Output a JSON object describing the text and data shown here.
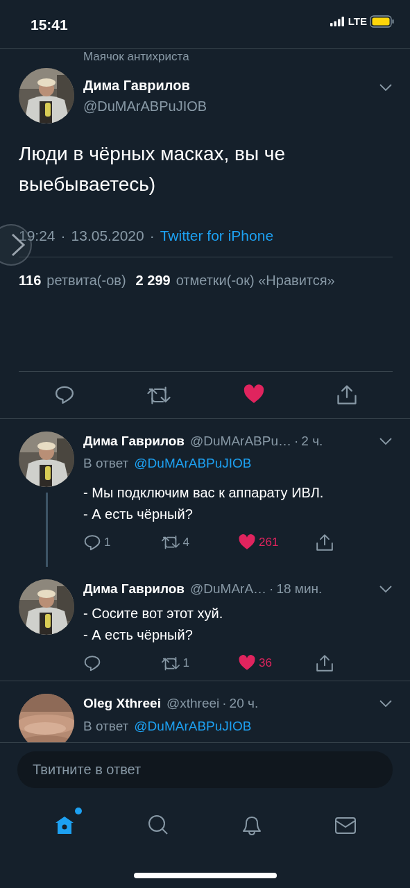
{
  "status_bar": {
    "time": "15:41",
    "network": "LTE"
  },
  "context_label": "Маячок антихриста",
  "main_tweet": {
    "name": "Дима Гаврилов",
    "handle": "@DuMArABPuJIOB",
    "text": "Люди в чёрных масках, вы че выебываетесь)",
    "separator": "·",
    "time": "19:24",
    "date": "13.05.2020",
    "source": "Twitter for iPhone",
    "retweets": "116",
    "retweets_label": "ретвита(-ов)",
    "likes": "2 299",
    "likes_label": "отметки(-ок) «Нравится»",
    "liked": true
  },
  "replies": [
    {
      "name": "Дима Гаврилов",
      "handle": "@DuMArABPu…",
      "separator": "·",
      "time": "2 ч.",
      "reply_prefix": "В ответ",
      "reply_to": "@DuMArABPuJIOB",
      "text": "- Мы подключим вас к аппарату ИВЛ.\n- А есть чёрный?",
      "comments": "1",
      "retweets": "4",
      "likes": "261",
      "liked": true,
      "thread_line": true
    },
    {
      "name": "Дима Гаврилов",
      "handle": "@DuMArA…",
      "separator": "·",
      "time": "18 мин.",
      "text": "- Сосите вот этот хуй.\n- А есть чёрный?",
      "retweets": "1",
      "likes": "36",
      "liked": true,
      "thread_line": false
    },
    {
      "name": "Oleg Xthreei",
      "handle": "@xthreei",
      "separator": "·",
      "time": "20 ч.",
      "reply_prefix": "В ответ",
      "reply_to": "@DuMArABPuJIOB",
      "thread_line": false
    }
  ],
  "compose": {
    "placeholder": "Твитните в ответ"
  },
  "tab_bar": [
    {
      "kind": "home",
      "selected": true,
      "dot": true
    },
    {
      "kind": "search",
      "selected": false,
      "dot": false
    },
    {
      "kind": "notifications",
      "selected": false,
      "dot": false
    },
    {
      "kind": "messages",
      "selected": false,
      "dot": false
    }
  ]
}
